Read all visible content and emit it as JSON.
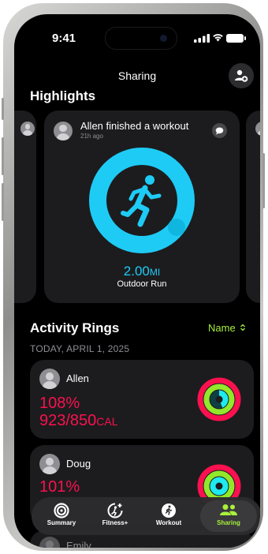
{
  "status_bar": {
    "time": "9:41"
  },
  "nav": {
    "title": "Sharing",
    "add_friend_icon": "person-add-icon"
  },
  "highlights": {
    "title": "Highlights",
    "card": {
      "headline": "Allen finished a workout",
      "time_ago": "21h ago",
      "distance_value": "2.00",
      "distance_unit": "MI",
      "workout_type": "Outdoor Run",
      "ring_color": "#1ecbf5"
    }
  },
  "activity": {
    "title": "Activity Rings",
    "sort_label": "Name",
    "date": "TODAY, APRIL 1, 2025",
    "friends": [
      {
        "name": "Allen",
        "percent": "108%",
        "calories": "923/850",
        "unit": "CAL"
      },
      {
        "name": "Doug",
        "percent": "101%",
        "calories": "",
        "unit": ""
      },
      {
        "name": "Emily"
      }
    ]
  },
  "tabs": [
    {
      "label": "Summary",
      "icon": "activity-rings-icon",
      "active": false
    },
    {
      "label": "Fitness+",
      "icon": "fitness-plus-icon",
      "active": false
    },
    {
      "label": "Workout",
      "icon": "running-figure-icon",
      "active": false
    },
    {
      "label": "Sharing",
      "icon": "people-icon",
      "active": true
    }
  ],
  "colors": {
    "move": "#fa114f",
    "exercise": "#92e82a",
    "stand": "#1eeaef",
    "accent": "#a8f03c",
    "background": "#000000",
    "card": "#1c1c1e"
  }
}
